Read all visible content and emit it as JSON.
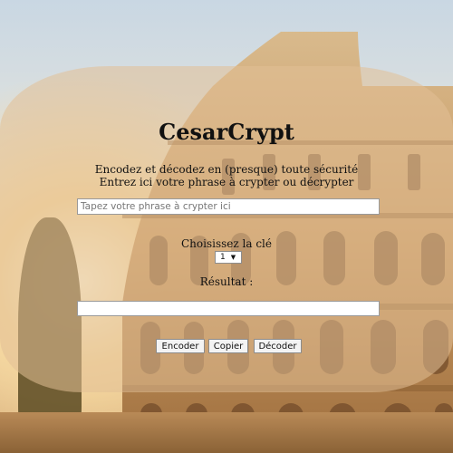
{
  "app": {
    "title": "CesarCrypt",
    "subtitle_line1": "Encodez et décodez en (presque) toute sécurité",
    "subtitle_line2": "Entrez ici votre phrase à crypter ou décrypter"
  },
  "form": {
    "input_placeholder": "Tapez votre phrase à crypter ici",
    "input_value": "",
    "key_label": "Choisissez la clé",
    "key_value": "1",
    "result_label": "Résultat :",
    "result_value": ""
  },
  "buttons": {
    "encode": "Encoder",
    "copy": "Copier",
    "decode": "Décoder"
  },
  "icons": {
    "select_arrow": "chevron-down-icon"
  },
  "colors": {
    "panel": "#e2c096",
    "text": "#111111",
    "button_bg": "#f3f3f3"
  }
}
